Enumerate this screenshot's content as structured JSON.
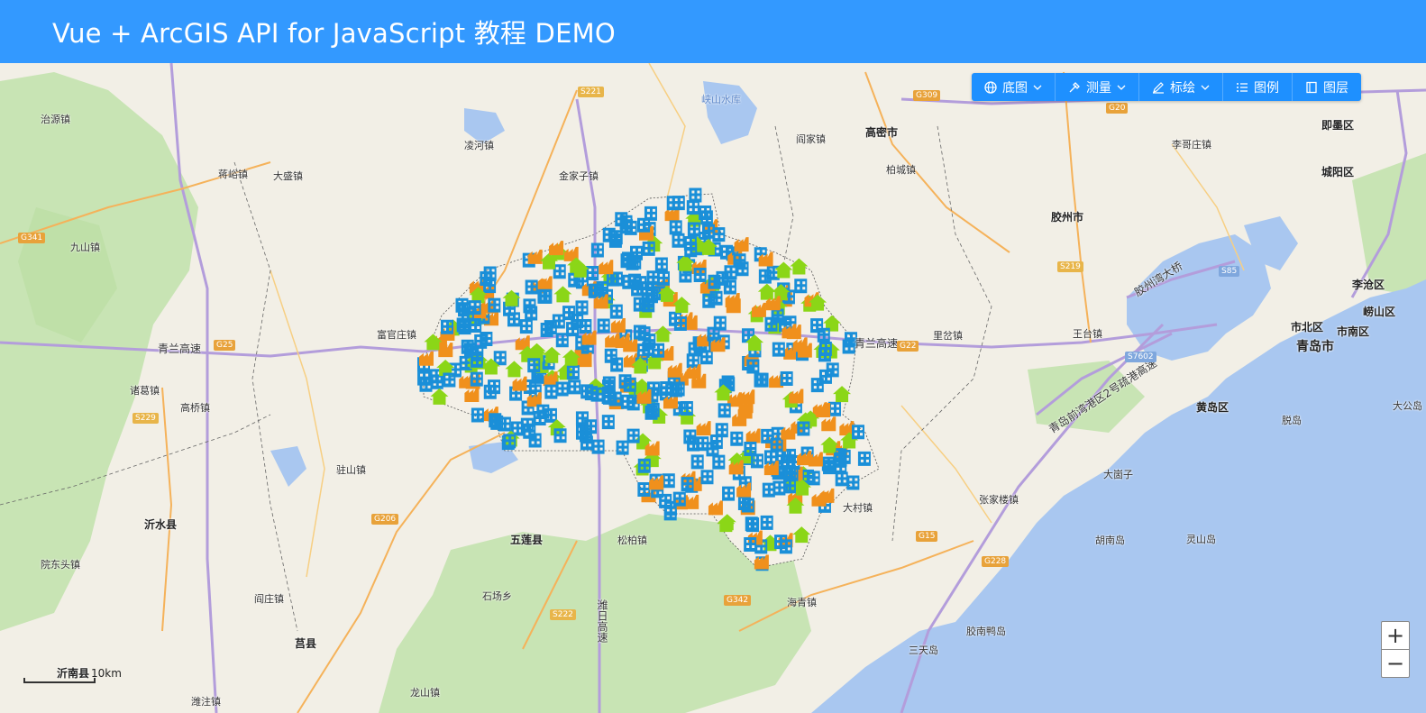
{
  "header": {
    "title": "Vue + ArcGIS API for JavaScript 教程 DEMO"
  },
  "toolbar": {
    "items": [
      {
        "label": "底图",
        "icon": "globe-icon",
        "dropdown": true
      },
      {
        "label": "测量",
        "icon": "ruler-icon",
        "dropdown": true
      },
      {
        "label": "标绘",
        "icon": "pen-icon",
        "dropdown": true
      },
      {
        "label": "图例",
        "icon": "list-icon",
        "dropdown": false
      },
      {
        "label": "图层",
        "icon": "layers-icon",
        "dropdown": false
      }
    ]
  },
  "zoom": {
    "in_label": "+",
    "out_label": "−"
  },
  "scale": {
    "label": "10km"
  },
  "colors": {
    "header": "#3399ff",
    "toolbar": "#1e90ff",
    "water": "#a9c7f0",
    "green": "#c5e3b0",
    "marker_blue": "#1a8fd8",
    "marker_orange": "#f0901c",
    "marker_green": "#8bd617"
  },
  "place_labels": [
    "治源镇",
    "峡山水库",
    "阎家镇",
    "高密市",
    "凌河镇",
    "蒋峪镇",
    "大盛镇",
    "金家子镇",
    "柏城镇",
    "李哥庄镇",
    "即墨区",
    "城阳区",
    "九山镇",
    "胶州市",
    "富官庄镇",
    "青兰高速",
    "崂山区",
    "李沧区",
    "市北区",
    "市南区",
    "青岛市",
    "王台镇",
    "里岔镇",
    "诸葛镇",
    "高桥镇",
    "黄岛区",
    "大公岛",
    "脱岛",
    "驻山镇",
    "大村镇",
    "大崮子",
    "张家楼镇",
    "沂水县",
    "五莲县",
    "松柏镇",
    "院东头镇",
    "胡南岛",
    "灵山岛",
    "阎庄镇",
    "石场乡",
    "海青镇",
    "莒县",
    "胶南鸭岛",
    "三天岛",
    "沂南县",
    "龙山镇",
    "潍注镇",
    "胶州湾大桥",
    "青岛前湾港区2号疏港高速",
    "潍日高速"
  ],
  "road_shields": [
    "G341",
    "S221",
    "G309",
    "G20",
    "G25",
    "G22",
    "S219",
    "S85",
    "S7602",
    "S229",
    "G206",
    "G15",
    "G228",
    "S222",
    "G342"
  ],
  "markers": {
    "types": [
      "blue-building",
      "orange-factory",
      "green-house"
    ]
  }
}
